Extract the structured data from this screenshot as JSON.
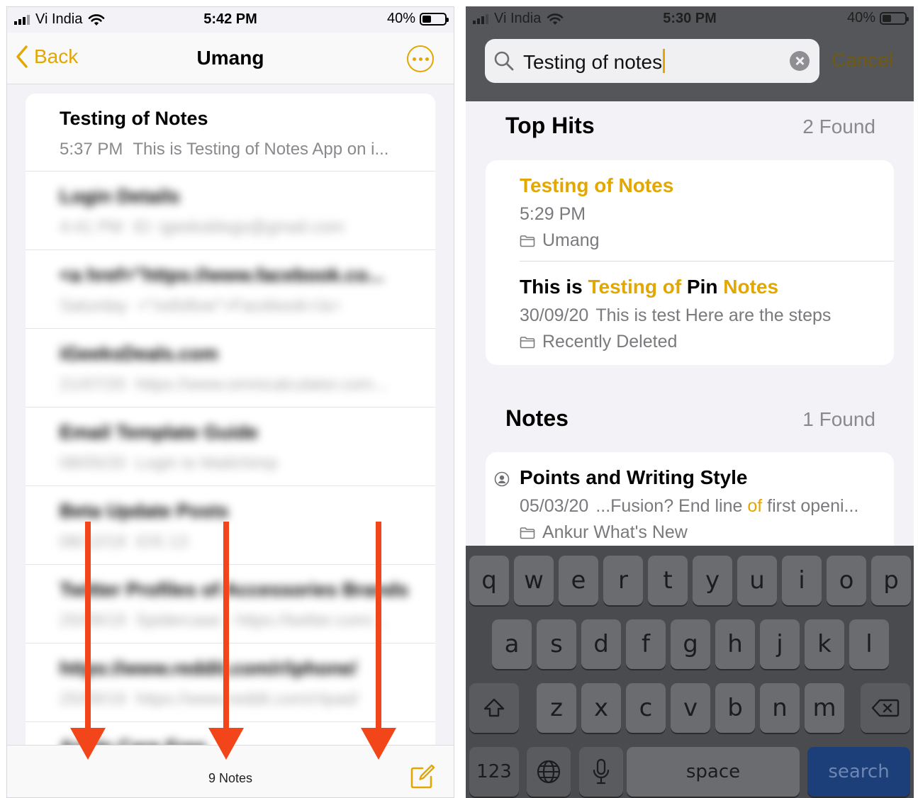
{
  "left": {
    "status": {
      "carrier": "Vi India",
      "time": "5:42 PM",
      "battery": "40%"
    },
    "nav": {
      "back_label": "Back",
      "title": "Umang"
    },
    "notes": [
      {
        "title": "Testing of Notes",
        "meta": "5:37 PM",
        "preview": "This is Testing of Notes App on i...",
        "blurred": false
      },
      {
        "title": "Login Details",
        "meta": "4:41 PM",
        "preview": "ID: igeeksblogs@gmail.com",
        "blurred": true
      },
      {
        "title": "<a href=\"https://www.facebook.co...",
        "meta": "Saturday",
        "preview": "<\"nofollow\">Facebook</a>",
        "blurred": true
      },
      {
        "title": "iGeeksDeals.com",
        "meta": "21/07/20",
        "preview": "https://www.omnicalculator.com...",
        "blurred": true
      },
      {
        "title": "Email Template Guide",
        "meta": "08/05/20",
        "preview": "Login to Mailchimp",
        "blurred": true
      },
      {
        "title": "Beta Update Posts",
        "meta": "08/12/19",
        "preview": "iOS 13",
        "blurred": true
      },
      {
        "title": "Twitter Profiles of Accessories Brands",
        "meta": "25/09/19",
        "preview": "Spidercase - https://twitter.com/...",
        "blurred": true
      },
      {
        "title": "https://www.reddit.com/r/iphone/",
        "meta": "25/09/19",
        "preview": "https://www.reddit.com/r/ipad/",
        "blurred": true
      },
      {
        "title": "Apple Care Free",
        "meta": "",
        "preview": "",
        "blurred": true
      }
    ],
    "toolbar": {
      "count": "9 Notes"
    },
    "colors": {
      "accent": "#e2a700",
      "arrow": "#f2461a"
    }
  },
  "right": {
    "status": {
      "carrier": "Vi India",
      "time": "5:30 PM",
      "battery": "40%"
    },
    "search": {
      "query": "Testing of notes",
      "cancel_label": "Cancel"
    },
    "top_hits": {
      "heading": "Top Hits",
      "count": "2 Found",
      "items": [
        {
          "title_parts": [
            {
              "text": "Testing of Notes",
              "hl": true
            }
          ],
          "meta": "5:29 PM",
          "preview": "",
          "folder": "Umang"
        },
        {
          "title_parts": [
            {
              "text": "This is ",
              "hl": false
            },
            {
              "text": "Testing of",
              "hl": true
            },
            {
              "text": " Pin ",
              "hl": false
            },
            {
              "text": "Notes",
              "hl": true
            }
          ],
          "meta": "30/09/20",
          "preview": "This is test Here are the steps",
          "folder": "Recently Deleted"
        }
      ]
    },
    "notes_section": {
      "heading": "Notes",
      "count": "1 Found",
      "items": [
        {
          "title": "Points and Writing Style",
          "meta": "05/03/20",
          "preview_parts": [
            {
              "text": "...Fusion? End line ",
              "hl": false
            },
            {
              "text": "of",
              "hl": true
            },
            {
              "text": " first openi...",
              "hl": false
            }
          ],
          "folder": "Ankur What's New",
          "shared": true
        }
      ]
    },
    "keyboard": {
      "row1": [
        "q",
        "w",
        "e",
        "r",
        "t",
        "y",
        "u",
        "i",
        "o",
        "p"
      ],
      "row2": [
        "a",
        "s",
        "d",
        "f",
        "g",
        "h",
        "j",
        "k",
        "l"
      ],
      "row3": [
        "z",
        "x",
        "c",
        "v",
        "b",
        "n",
        "m"
      ],
      "numbers_key": "123",
      "space_key": "space",
      "search_key": "search"
    }
  }
}
